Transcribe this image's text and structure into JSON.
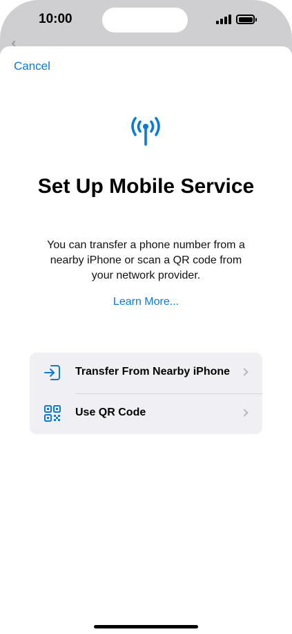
{
  "status_bar": {
    "time": "10:00"
  },
  "sheet": {
    "cancel_label": "Cancel",
    "title": "Set Up Mobile Service",
    "description": "You can transfer a phone number from a nearby iPhone or scan a QR code from your network provider.",
    "learn_more": "Learn More..."
  },
  "options": [
    {
      "label": "Transfer From Nearby iPhone",
      "icon": "transfer-icon"
    },
    {
      "label": "Use QR Code",
      "icon": "qr-code-icon"
    }
  ],
  "colors": {
    "accent": "#0a7ad6",
    "group_bg": "#efeff4",
    "frame": "#cfcfd1"
  }
}
